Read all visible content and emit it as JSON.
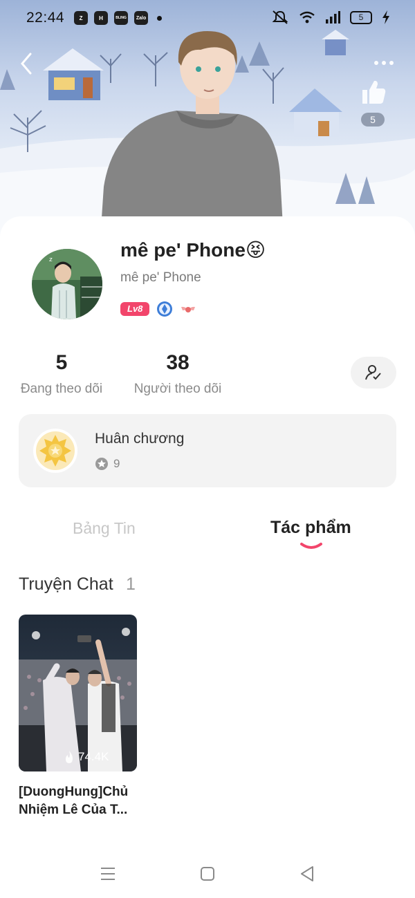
{
  "status_bar": {
    "time": "22:44",
    "apps": [
      "Z",
      "H",
      "BLING",
      "Zalo"
    ],
    "battery": "5"
  },
  "header": {
    "like_count": "5",
    "icons": [
      "back-arrow-icon",
      "more-dots-icon",
      "thumbs-up-icon"
    ]
  },
  "profile": {
    "display_name": "mê pe' Phone😝",
    "handle": "mê pe' Phone",
    "level": "Lv8",
    "badge_icons": [
      "diamond-badge-icon",
      "wings-badge-icon"
    ]
  },
  "stats": {
    "following_count": "5",
    "following_label": "Đang theo dõi",
    "followers_count": "38",
    "followers_label": "Người theo dõi"
  },
  "medals": {
    "title": "Huân chương",
    "count": "9"
  },
  "tabs": {
    "news": "Bảng Tin",
    "works": "Tác phẩm",
    "active": "works"
  },
  "section": {
    "title": "Truyện Chat",
    "count": "1"
  },
  "stories": [
    {
      "title": "[DuongHung]Chủ Nhiệm Lê Của T...",
      "views": "74.4K"
    }
  ],
  "colors": {
    "accent": "#f2456b",
    "tab_inactive": "#c7c7c7",
    "card_bg": "#f3f3f3"
  }
}
